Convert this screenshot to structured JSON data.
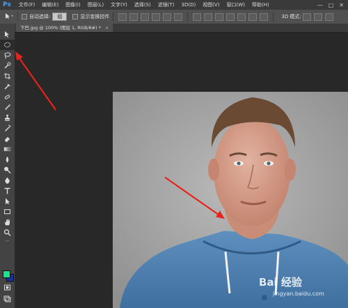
{
  "app": {
    "logo": "Ps"
  },
  "menu": [
    "文件(F)",
    "编辑(E)",
    "图像(I)",
    "图层(L)",
    "文字(Y)",
    "选择(S)",
    "滤镜(T)",
    "3D(D)",
    "视图(V)",
    "窗口(W)",
    "帮助(H)"
  ],
  "window_controls": {
    "minimize": "—",
    "maximize": "□",
    "close": "✕"
  },
  "options": {
    "auto_select_label": "自动选择:",
    "auto_select_value": "组",
    "show_transform_label": "显示变换控件",
    "mode_3d_label": "3D 模式:"
  },
  "document": {
    "tab_title": "下巴.jpg @ 100% (图层 1, RGB/8#) *",
    "close": "×"
  },
  "colors": {
    "foreground": "#1de38a",
    "background": "#1b2f9c",
    "arrow": "#e8231c"
  },
  "watermark": {
    "main": "Bai 经验",
    "sub": "jingyan.baidu.com"
  }
}
